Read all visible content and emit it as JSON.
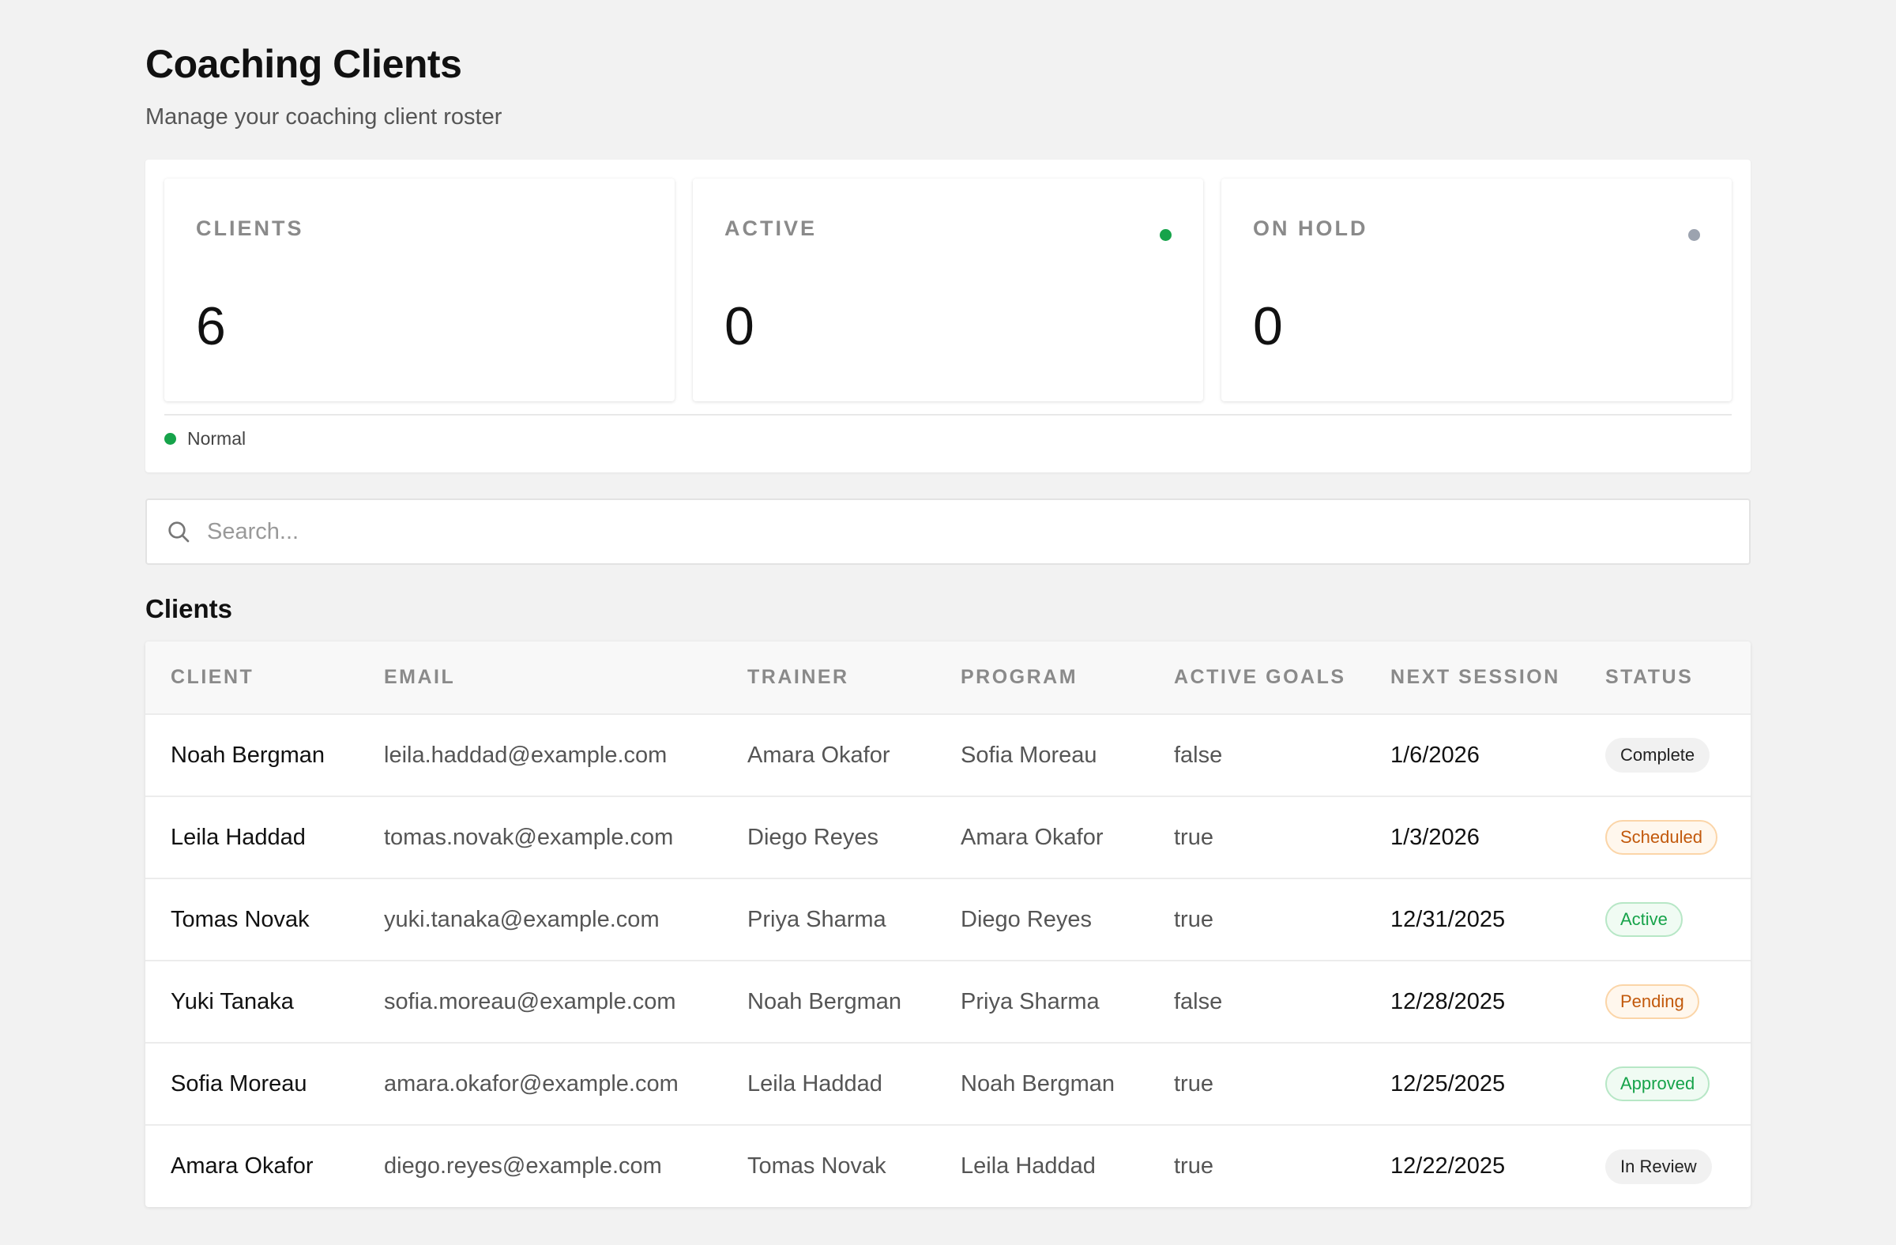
{
  "header": {
    "title": "Coaching Clients",
    "subtitle": "Manage your coaching client roster"
  },
  "stats": [
    {
      "label": "CLIENTS",
      "value": "6",
      "dot_color": null
    },
    {
      "label": "ACTIVE",
      "value": "0",
      "dot_color": "#16a34a"
    },
    {
      "label": "ON HOLD",
      "value": "0",
      "dot_color": "#9ca3af"
    }
  ],
  "legend": {
    "label": "Normal",
    "color": "#16a34a"
  },
  "search": {
    "placeholder": "Search...",
    "value": ""
  },
  "table": {
    "section_title": "Clients",
    "columns": [
      "CLIENT",
      "EMAIL",
      "TRAINER",
      "PROGRAM",
      "ACTIVE GOALS",
      "NEXT SESSION",
      "STATUS"
    ],
    "rows": [
      {
        "client": "Noah Bergman",
        "email": "leila.haddad@example.com",
        "trainer": "Amara Okafor",
        "program": "Sofia Moreau",
        "active_goals": "false",
        "next_session": "1/6/2026",
        "status": "Complete",
        "status_style": "neutral"
      },
      {
        "client": "Leila Haddad",
        "email": "tomas.novak@example.com",
        "trainer": "Diego Reyes",
        "program": "Amara Okafor",
        "active_goals": "true",
        "next_session": "1/3/2026",
        "status": "Scheduled",
        "status_style": "scheduled"
      },
      {
        "client": "Tomas Novak",
        "email": "yuki.tanaka@example.com",
        "trainer": "Priya Sharma",
        "program": "Diego Reyes",
        "active_goals": "true",
        "next_session": "12/31/2025",
        "status": "Active",
        "status_style": "active"
      },
      {
        "client": "Yuki Tanaka",
        "email": "sofia.moreau@example.com",
        "trainer": "Noah Bergman",
        "program": "Priya Sharma",
        "active_goals": "false",
        "next_session": "12/28/2025",
        "status": "Pending",
        "status_style": "pending"
      },
      {
        "client": "Sofia Moreau",
        "email": "amara.okafor@example.com",
        "trainer": "Leila Haddad",
        "program": "Noah Bergman",
        "active_goals": "true",
        "next_session": "12/25/2025",
        "status": "Approved",
        "status_style": "approved"
      },
      {
        "client": "Amara Okafor",
        "email": "diego.reyes@example.com",
        "trainer": "Tomas Novak",
        "program": "Leila Haddad",
        "active_goals": "true",
        "next_session": "12/22/2025",
        "status": "In Review",
        "status_style": "neutral"
      }
    ]
  }
}
